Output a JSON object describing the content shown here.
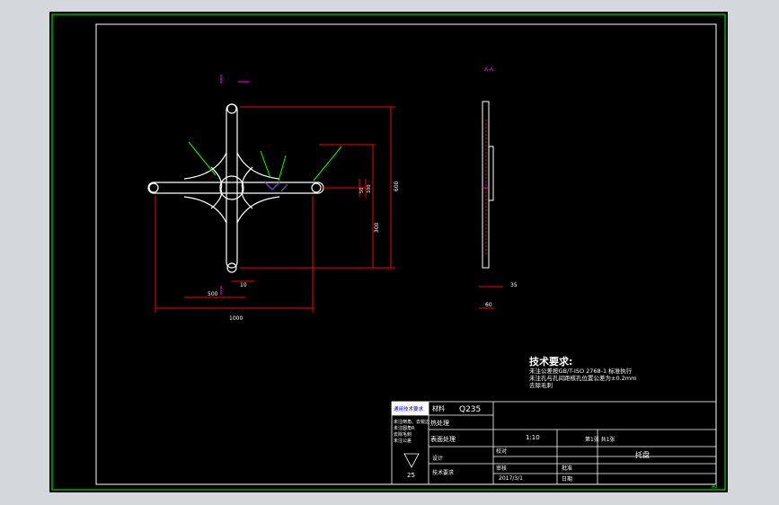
{
  "colors": {
    "background": "#000000",
    "frame": "#00ff00",
    "part": "#ffffff",
    "dimension": "#ff0000",
    "center": "#ff00ff",
    "annotation": "#7b3fe0",
    "titleblock": "#ffffff",
    "leader": "#00ff00"
  },
  "drawing": {
    "section_label": "A-A",
    "tech_title": "技术要求:",
    "tech_notes": [
      "未注公差按GB/T-ISO 2768-1 标准执行",
      "未注孔与孔间距核孔位置公差为±0.2mm",
      "去除毛刺"
    ],
    "dims_front": {
      "height_total": "600",
      "height_right": "300",
      "width_total": "1000",
      "bottom_a": "500",
      "bottom_b": "10",
      "hole_a": "50",
      "hole_b": "100"
    },
    "dims_side": {
      "thickness": "60",
      "offset": "35"
    },
    "corner_mark": "A3"
  },
  "titleblock": {
    "header_left": "通用技术要求",
    "material_label": "材料",
    "material_value": "Q235",
    "heat_label": "热处理",
    "surface_label": "表面处理",
    "mark_value": "25",
    "scale_value": "1:10",
    "date_value": "2017/3/1",
    "part_name": "托盘",
    "row_labels": [
      "设计",
      "校对",
      "审核",
      "批准",
      "日期"
    ],
    "notes_left": [
      "未注倒角、去锐边",
      "未注圆角R",
      "去除毛刺",
      "未注公差"
    ],
    "sheet": "第1张 共1张",
    "tech_req_label": "技术要求"
  }
}
